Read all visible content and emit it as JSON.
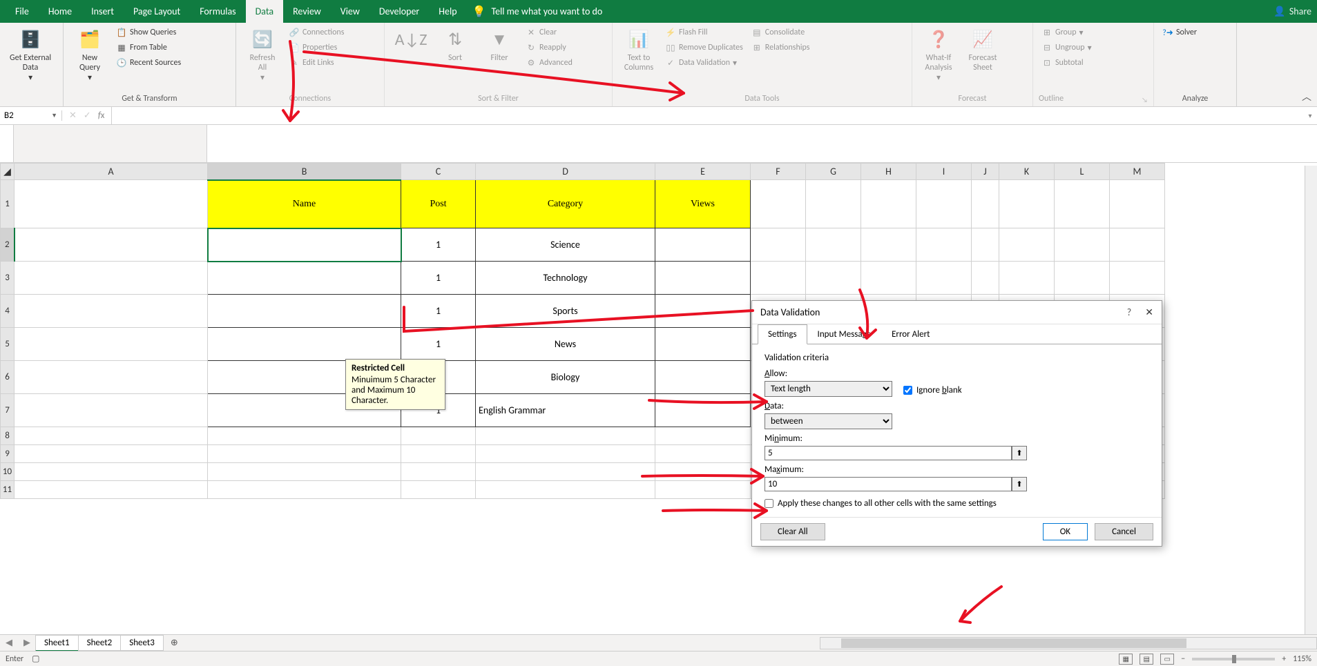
{
  "menu": {
    "tabs": [
      "File",
      "Home",
      "Insert",
      "Page Layout",
      "Formulas",
      "Data",
      "Review",
      "View",
      "Developer",
      "Help"
    ],
    "active": "Data",
    "tellme": "Tell me what you want to do",
    "share": "Share"
  },
  "ribbon": {
    "groups": {
      "ext": {
        "label": "",
        "btn": "Get External\nData"
      },
      "get": {
        "label": "Get & Transform",
        "new_query": "New\nQuery",
        "show_queries": "Show Queries",
        "from_table": "From Table",
        "recent": "Recent Sources"
      },
      "conn": {
        "label": "Connections",
        "refresh": "Refresh\nAll",
        "connections": "Connections",
        "properties": "Properties",
        "edit_links": "Edit Links"
      },
      "sortfilter": {
        "label": "Sort & Filter",
        "sort": "Sort",
        "filter": "Filter",
        "clear": "Clear",
        "reapply": "Reapply",
        "advanced": "Advanced"
      },
      "datatools": {
        "label": "Data Tools",
        "ttc": "Text to\nColumns",
        "flash": "Flash Fill",
        "dupes": "Remove Duplicates",
        "dv": "Data Validation",
        "consol": "Consolidate",
        "rel": "Relationships"
      },
      "forecast": {
        "label": "Forecast",
        "whatif": "What-If\nAnalysis",
        "forecast": "Forecast\nSheet"
      },
      "outline": {
        "label": "Outline",
        "group": "Group",
        "ungroup": "Ungroup",
        "subtotal": "Subtotal"
      },
      "analyze": {
        "label": "Analyze",
        "solver": "Solver"
      }
    }
  },
  "namebox": "B2",
  "sheet": {
    "cols": [
      "A",
      "B",
      "C",
      "D",
      "E",
      "F",
      "G",
      "H",
      "I",
      "J",
      "K",
      "L",
      "M"
    ],
    "rows": [
      "1",
      "2",
      "3",
      "4",
      "5",
      "6",
      "7",
      "8",
      "9",
      "10",
      "11"
    ],
    "headers": {
      "b": "Name",
      "c": "Post",
      "d": "Category",
      "e": "Views"
    },
    "data": [
      {
        "c": "1",
        "d": "Science"
      },
      {
        "c": "1",
        "d": "Technology"
      },
      {
        "c": "1",
        "d": "Sports"
      },
      {
        "c": "1",
        "d": "News"
      },
      {
        "c": "1",
        "d": "Biology"
      },
      {
        "c": "1",
        "d": "English Grammar"
      }
    ]
  },
  "tooltip": {
    "title": "Restricted Cell",
    "body": "Minuimum 5 Character and Maximum 10 Character."
  },
  "dialog": {
    "title": "Data Validation",
    "tabs": [
      "Settings",
      "Input Message",
      "Error Alert"
    ],
    "criteria": "Validation criteria",
    "allow_label": "Allow:",
    "allow_value": "Text length",
    "ignore_blank": "Ignore blank",
    "data_label": "Data:",
    "data_value": "between",
    "min_label": "Minimum:",
    "min_value": "5",
    "max_label": "Maximum:",
    "max_value": "10",
    "apply_all": "Apply these changes to all other cells with the same settings",
    "clear": "Clear All",
    "ok": "OK",
    "cancel": "Cancel"
  },
  "sheets": {
    "tabs": [
      "Sheet1",
      "Sheet2",
      "Sheet3"
    ],
    "active": "Sheet1"
  },
  "status": {
    "mode": "Enter",
    "zoom": "115%"
  }
}
